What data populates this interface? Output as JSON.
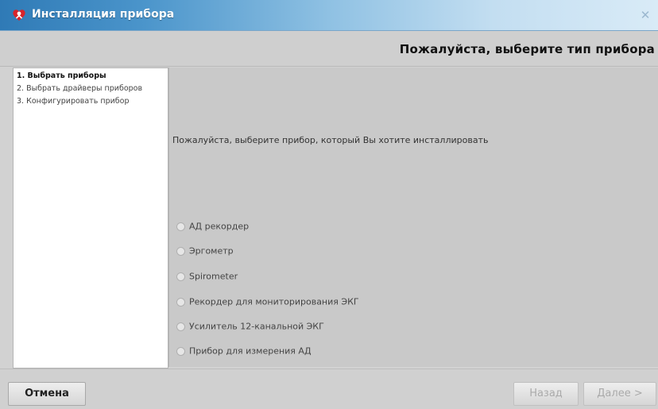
{
  "window": {
    "title": "Инсталляция прибора",
    "close_glyph": "✕",
    "app_icon": "heart-person-icon"
  },
  "header": {
    "title": "Пожалуйста, выберите тип прибора"
  },
  "steps": [
    {
      "label": "1. Выбрать приборы",
      "active": true
    },
    {
      "label": "2. Выбрать драйверы приборов",
      "active": false
    },
    {
      "label": "3. Конфигурировать прибор",
      "active": false
    }
  ],
  "main": {
    "prompt": "Пожалуйста, выберите прибор, который Вы хотите инсталлировать",
    "options": [
      {
        "label": "АД рекордер",
        "selected": false
      },
      {
        "label": "Эргометр",
        "selected": false
      },
      {
        "label": "Spirometer",
        "selected": false
      },
      {
        "label": "Рекордер для мониторирования ЭКГ",
        "selected": false
      },
      {
        "label": "Усилитель 12-канальной ЭКГ",
        "selected": false
      },
      {
        "label": "Прибор для измерения АД",
        "selected": false
      }
    ]
  },
  "buttons": {
    "cancel": "Отмена",
    "back": "Назад",
    "next": "Далее >"
  },
  "colors": {
    "titlebar_start": "#2f7ab6",
    "titlebar_end": "#d9ebf7",
    "icon_red": "#d8232a"
  }
}
